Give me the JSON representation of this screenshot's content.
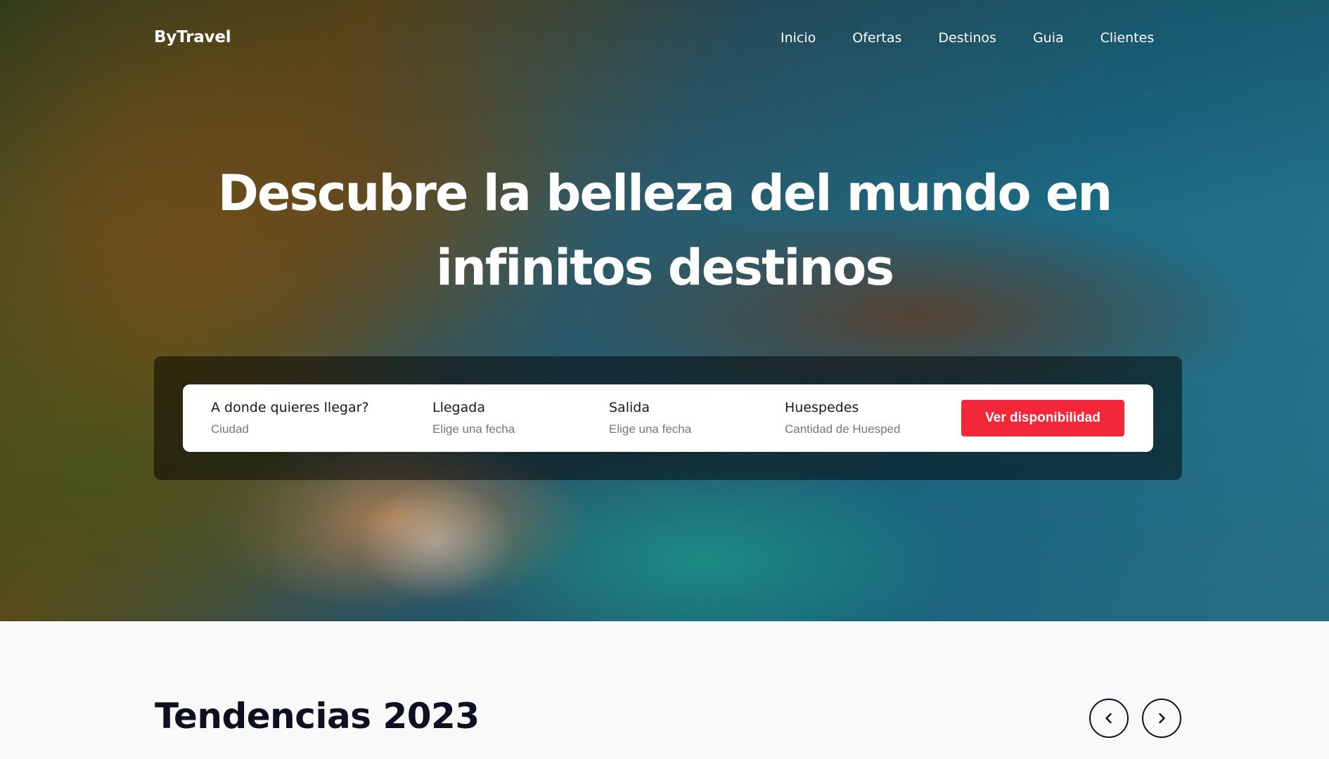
{
  "nav": {
    "logo": "ByTravel",
    "items": [
      {
        "label": "Inicio"
      },
      {
        "label": "Ofertas"
      },
      {
        "label": "Destinos"
      },
      {
        "label": "Guia"
      },
      {
        "label": "Clientes"
      }
    ]
  },
  "hero": {
    "headline_line1": "Descubre la belleza del mundo en",
    "headline_line2": "infinitos destinos"
  },
  "search": {
    "fields": [
      {
        "label": "A donde quieres llegar?",
        "hint": "Ciudad"
      },
      {
        "label": "Llegada",
        "hint": "Elige una fecha"
      },
      {
        "label": "Salida",
        "hint": "Elige una fecha"
      },
      {
        "label": "Huespedes",
        "hint": "Cantidad de Huesped"
      }
    ],
    "cta_label": "Ver disponibilidad"
  },
  "trends": {
    "title": "Tendencias 2023",
    "prev_icon": "chevron-left-icon",
    "next_icon": "chevron-right-icon"
  },
  "colors": {
    "accent": "#f4263a",
    "text_dark": "#0d1020",
    "page_bg": "#f9f9f9"
  }
}
